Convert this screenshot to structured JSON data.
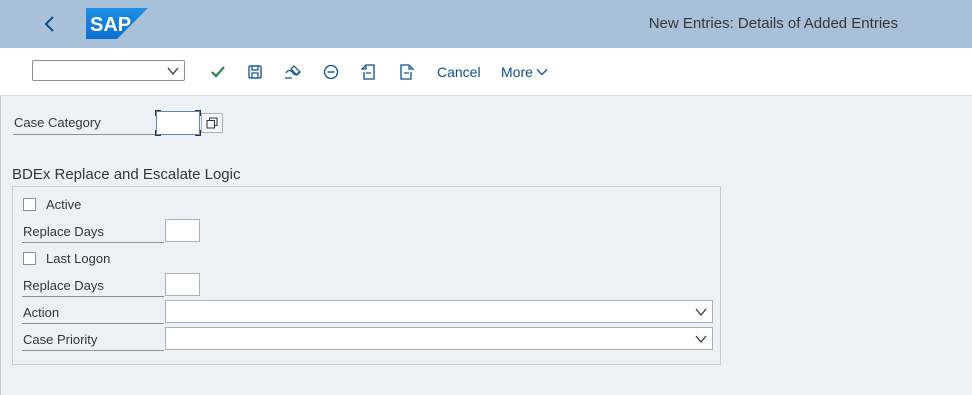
{
  "header": {
    "title": "New Entries: Details of Added Entries",
    "logo_text": "SAP",
    "logo_color": "#0a6ed1",
    "background": "#a9c1d8"
  },
  "toolbar": {
    "select_value": "",
    "icons": [
      "check-icon",
      "save-icon",
      "display-change-icon",
      "delete-icon",
      "previous-entry-icon",
      "next-entry-icon",
      "chevron-down-icon"
    ],
    "cancel_label": "Cancel",
    "more_label": "More"
  },
  "form": {
    "case_category": {
      "label": "Case Category",
      "value": ""
    }
  },
  "section": {
    "title": "BDEx Replace and Escalate Logic",
    "active": {
      "label": "Active",
      "checked": false
    },
    "replace_days_1": {
      "label": "Replace Days",
      "value": ""
    },
    "last_logon": {
      "label": "Last Logon",
      "checked": false
    },
    "replace_days_2": {
      "label": "Replace Days",
      "value": ""
    },
    "action": {
      "label": "Action",
      "value": ""
    },
    "case_priority": {
      "label": "Case Priority",
      "value": ""
    }
  }
}
